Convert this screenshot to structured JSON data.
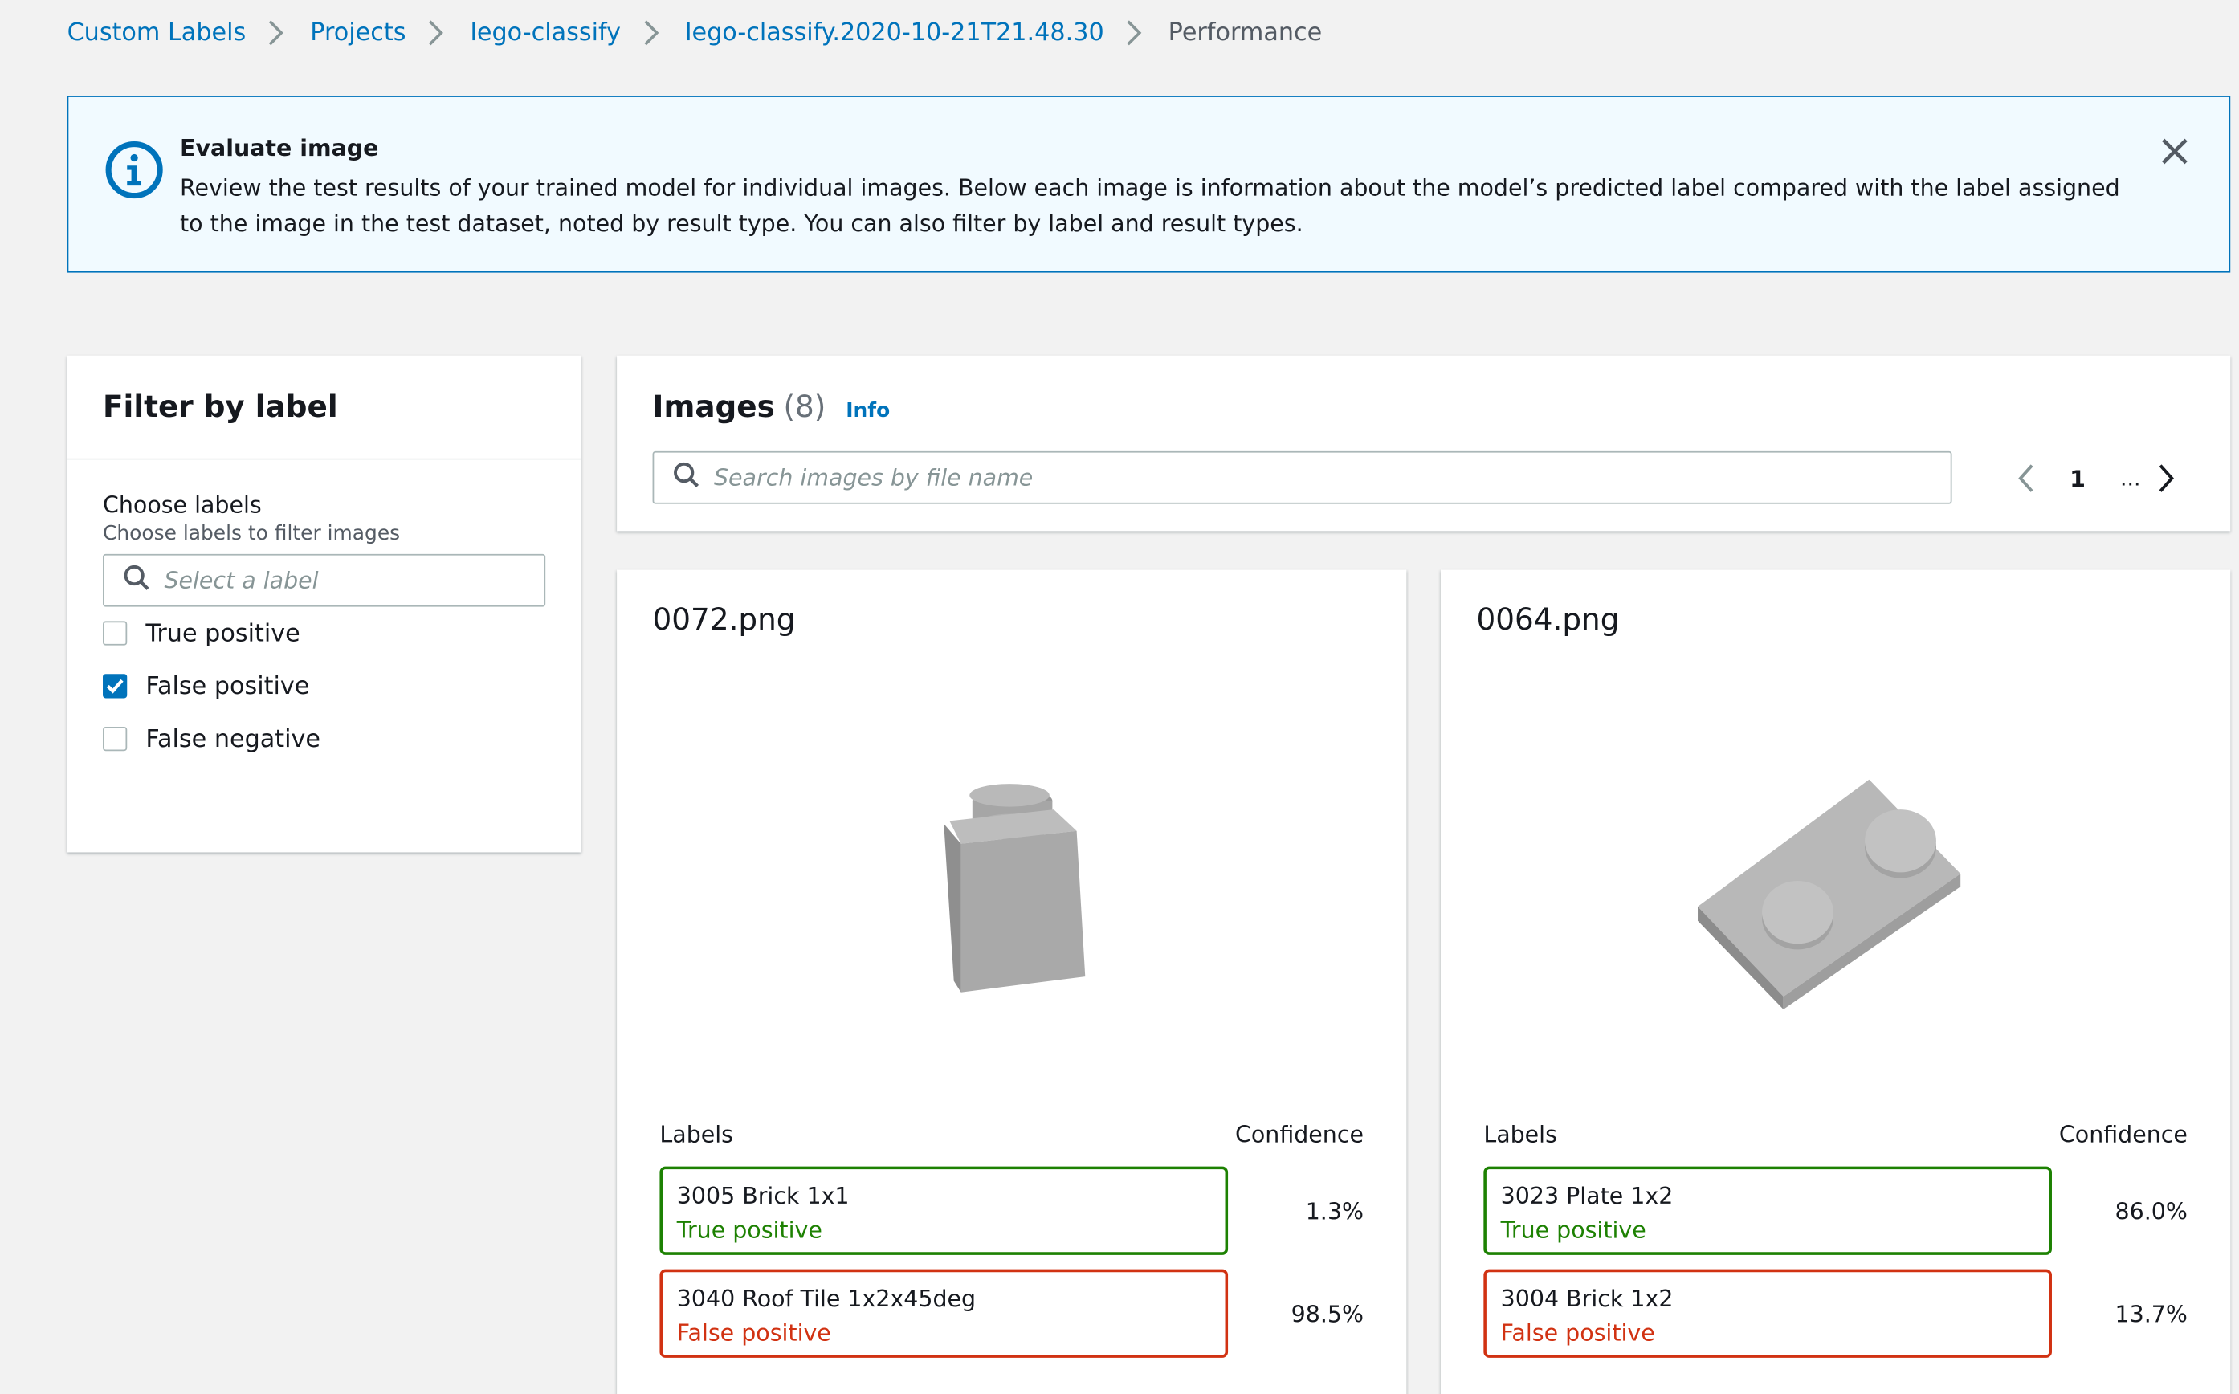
{
  "breadcrumb": {
    "items": [
      "Custom Labels",
      "Projects",
      "lego-classify",
      "lego-classify.2020-10-21T21.48.30"
    ],
    "current": "Performance"
  },
  "flash": {
    "title": "Evaluate image",
    "body": "Review the test results of your trained model for individual images. Below each image is information about the model’s predicted label compared with the label assigned to the image in the test dataset, noted by result type. You can also filter by label and result types."
  },
  "filter": {
    "heading": "Filter by label",
    "choose_title": "Choose labels",
    "choose_desc": "Choose labels to filter images",
    "select_placeholder": "Select a label",
    "options": [
      {
        "label": "True positive",
        "checked": false
      },
      {
        "label": "False positive",
        "checked": true
      },
      {
        "label": "False negative",
        "checked": false
      }
    ]
  },
  "images": {
    "title": "Images",
    "count": "(8)",
    "info": "Info",
    "search_placeholder": "Search images by file name",
    "page": "1",
    "ellipsis": "..."
  },
  "cards": [
    {
      "file": "0072.png",
      "labels_header": "Labels",
      "confidence_header": "Confidence",
      "results": [
        {
          "name": "3005 Brick 1x1",
          "type": "True positive",
          "confidence": "1.3%"
        },
        {
          "name": "3040 Roof Tile 1x2x45deg",
          "type": "False positive",
          "confidence": "98.5%"
        }
      ]
    },
    {
      "file": "0064.png",
      "labels_header": "Labels",
      "confidence_header": "Confidence",
      "results": [
        {
          "name": "3023 Plate 1x2",
          "type": "True positive",
          "confidence": "86.0%"
        },
        {
          "name": "3004 Brick 1x2",
          "type": "False positive",
          "confidence": "13.7%"
        }
      ]
    }
  ],
  "colors": {
    "link": "#0073bb",
    "positive": "#1d8102",
    "negative": "#d13212",
    "info_bg": "#f1faff"
  }
}
